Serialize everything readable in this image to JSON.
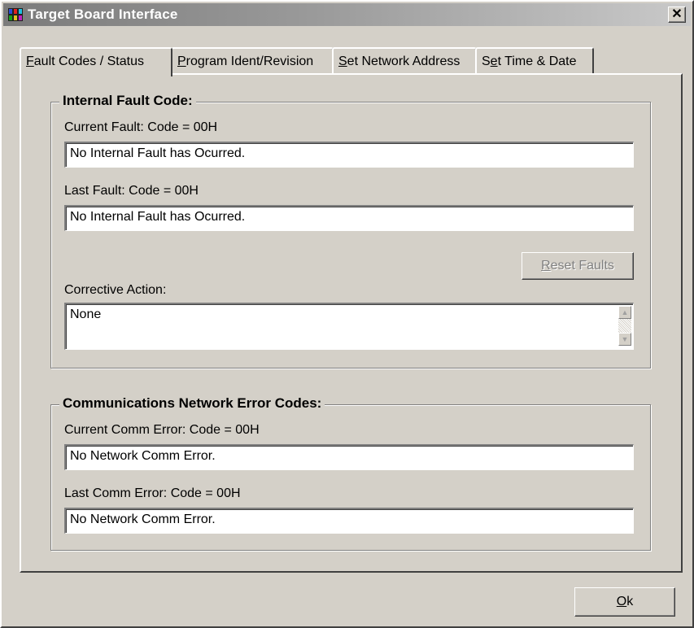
{
  "window": {
    "title": "Target Board Interface",
    "close_label": "✕",
    "titlebar_gradient": [
      "#7b7b7b",
      "#c9c9c9"
    ]
  },
  "tabs": [
    {
      "mnemonic": "F",
      "rest": "ault Codes / Status",
      "active": true
    },
    {
      "mnemonic": "P",
      "rest": "rogram Ident/Revision",
      "active": false
    },
    {
      "mnemonic": "S",
      "rest": "et Network Address",
      "active": false
    },
    {
      "prefix": "S",
      "mnemonic": "e",
      "rest": "t Time & Date",
      "active": false
    }
  ],
  "internal_fault": {
    "title": "Internal Fault Code:",
    "current_label": "Current Fault: Code = 00H",
    "current_value": "No Internal Fault has Ocurred.",
    "last_label": "Last Fault: Code = 00H",
    "last_value": "No Internal Fault has Ocurred.",
    "reset_button": {
      "mnemonic": "R",
      "rest": "eset Faults",
      "enabled": false
    },
    "corrective_label": "Corrective Action:",
    "corrective_value": "None",
    "scroll_up_icon": "arrow-up",
    "scroll_down_icon": "arrow-down"
  },
  "comm_errors": {
    "title": "Communications Network Error Codes:",
    "current_label": "Current Comm Error: Code = 00H",
    "current_value": "No Network Comm Error.",
    "last_label": "Last Comm Error: Code = 00H",
    "last_value": "No Network Comm Error."
  },
  "ok_button": {
    "mnemonic": "O",
    "rest": "k"
  },
  "colors": {
    "face": "#d4d0c8",
    "title_text": "#ffffff",
    "disabled_text": "#808080"
  }
}
